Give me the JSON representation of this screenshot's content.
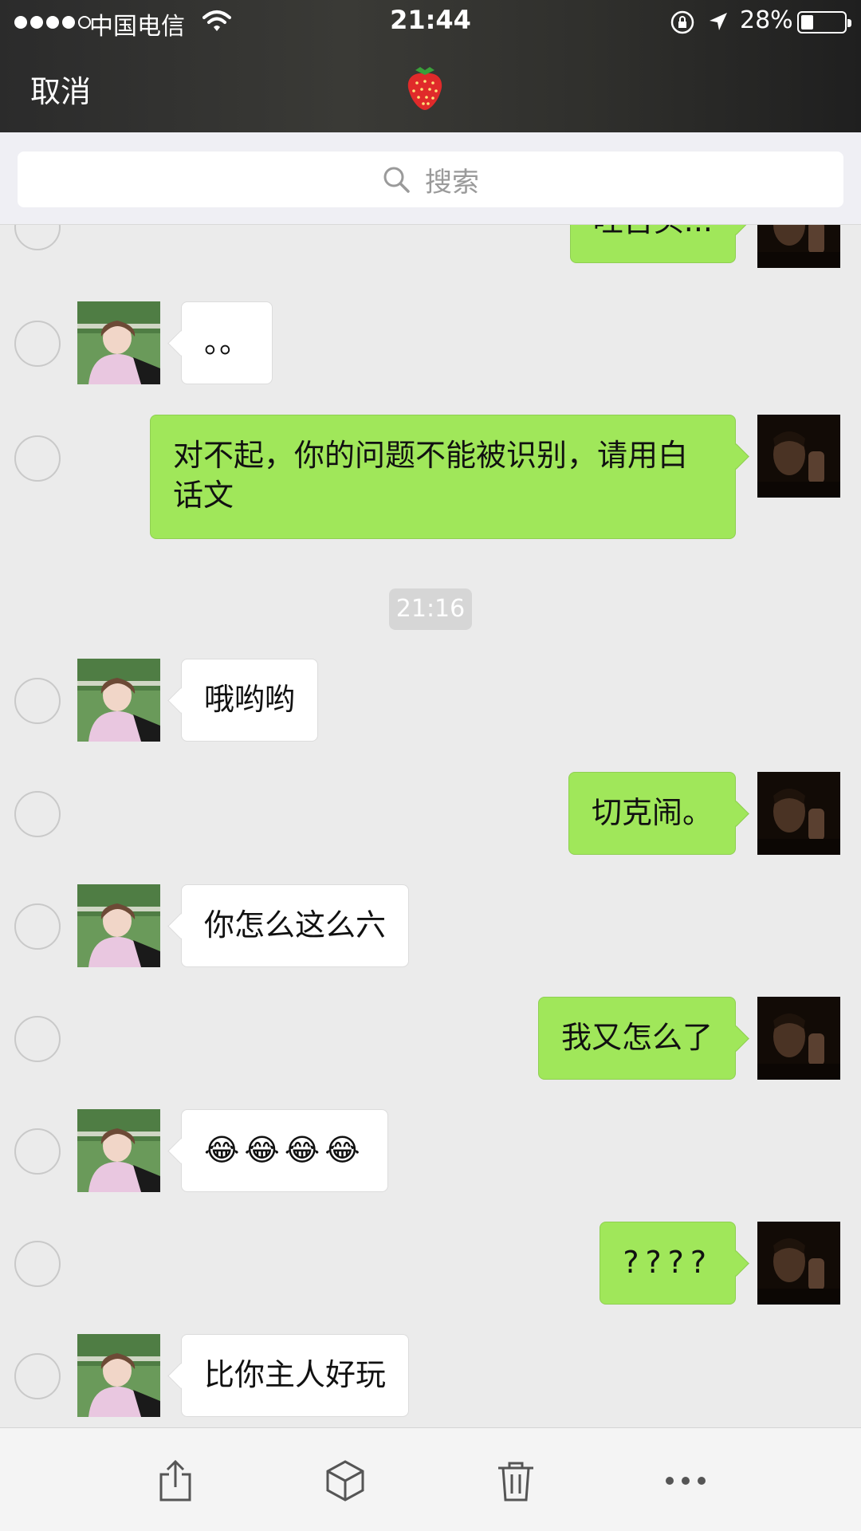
{
  "status_bar": {
    "carrier": "中国电信",
    "time": "21:44",
    "battery_percent_text": "28%",
    "battery_level": 0.28,
    "signal_bars_filled": 4,
    "signal_bars_total": 5
  },
  "nav": {
    "cancel_label": "取消",
    "title_icon": "strawberry-icon"
  },
  "search": {
    "placeholder": "搜索"
  },
  "colors": {
    "outgoing_bubble": "#a0e75a",
    "incoming_bubble": "#ffffff",
    "chat_background": "#ebebeb"
  },
  "messages": [
    {
      "side": "out",
      "text": "吐舌头..."
    },
    {
      "side": "in",
      "text": "。。"
    },
    {
      "side": "out",
      "text": "对不起，你的问题不能被识别，请用白话文"
    },
    {
      "side": "in",
      "text": "哦哟哟"
    },
    {
      "side": "out",
      "text": "切克闹。"
    },
    {
      "side": "in",
      "text": "你怎么这么六"
    },
    {
      "side": "out",
      "text": "我又怎么了"
    },
    {
      "side": "in",
      "text": "😂😂😂😂"
    },
    {
      "side": "out",
      "text": "????"
    },
    {
      "side": "in",
      "text": "比你主人好玩"
    }
  ],
  "timestamp": "21:16",
  "toolbar": {
    "items": [
      "share-icon",
      "box-icon",
      "trash-icon",
      "more-icon"
    ]
  }
}
